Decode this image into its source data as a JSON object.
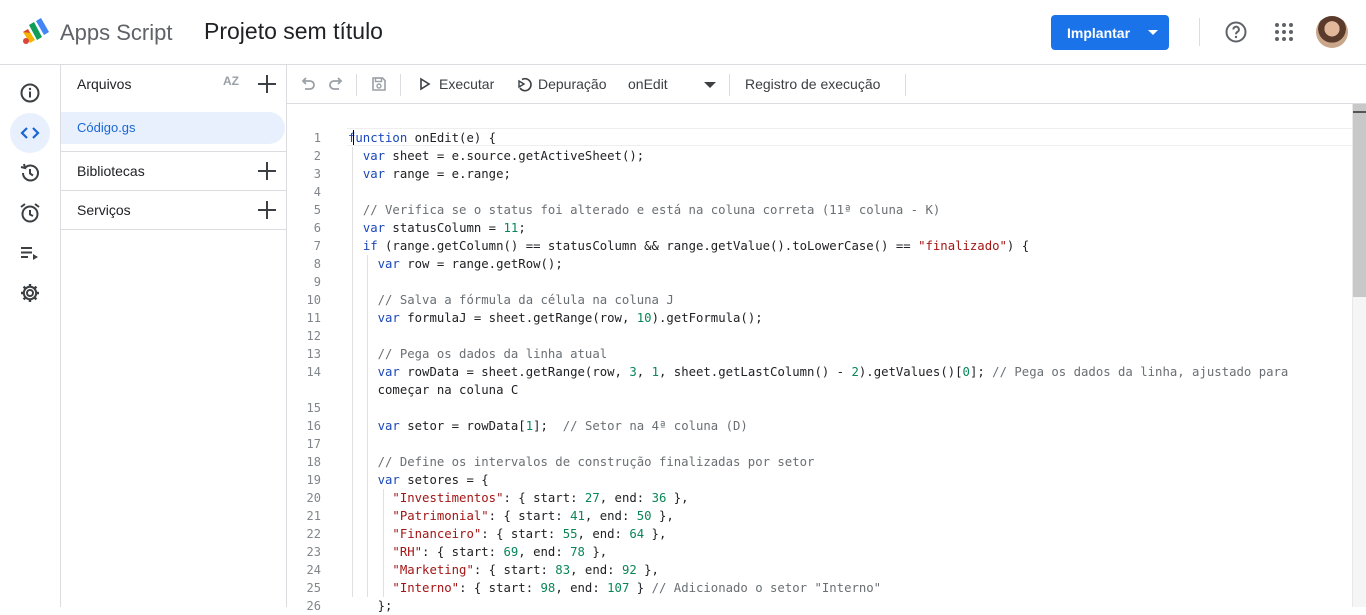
{
  "header": {
    "app_name": "Apps Script",
    "project_title": "Projeto sem título",
    "deploy_label": "Implantar"
  },
  "files_panel": {
    "title": "Arquivos",
    "sort_label": "AZ",
    "active_file": "Código.gs",
    "sections": [
      "Bibliotecas",
      "Serviços"
    ]
  },
  "toolbar": {
    "run_label": "Executar",
    "debug_label": "Depuração",
    "function_select": "onEdit",
    "exec_log_label": "Registro de execução"
  },
  "editor": {
    "line_numbers": [
      "1",
      "2",
      "3",
      "4",
      "5",
      "6",
      "7",
      "8",
      "9",
      "10",
      "11",
      "12",
      "13",
      "14",
      "",
      "15",
      "16",
      "17",
      "18",
      "19",
      "20",
      "21",
      "22",
      "23",
      "24",
      "25",
      "26"
    ],
    "lines": [
      "function onEdit(e) {",
      "  var sheet = e.source.getActiveSheet();",
      "  var range = e.range;",
      "",
      "  // Verifica se o status foi alterado e está na coluna correta (11ª coluna - K)",
      "  var statusColumn = 11;",
      "  if (range.getColumn() == statusColumn && range.getValue().toLowerCase() == \"finalizado\") {",
      "    var row = range.getRow();",
      "",
      "    // Salva a fórmula da célula na coluna J",
      "    var formulaJ = sheet.getRange(row, 10).getFormula();",
      "",
      "    // Pega os dados da linha atual",
      "    var rowData = sheet.getRange(row, 3, 1, sheet.getLastColumn() - 2).getValues()[0]; // Pega os dados da linha, ajustado para",
      "    começar na coluna C",
      "",
      "    var setor = rowData[1];  // Setor na 4ª coluna (D)",
      "",
      "    // Define os intervalos de construção finalizadas por setor",
      "    var setores = {",
      "      \"Investimentos\": { start: 27, end: 36 },",
      "      \"Patrimonial\": { start: 41, end: 50 },",
      "      \"Financeiro\": { start: 55, end: 64 },",
      "      \"RH\": { start: 69, end: 78 },",
      "      \"Marketing\": { start: 83, end: 92 },",
      "      \"Interno\": { start: 98, end: 107 } // Adicionado o setor \"Interno\"",
      "    };"
    ]
  },
  "colors": {
    "accent": "#1a73e8",
    "keyword": "#1a47b8",
    "string": "#a31515",
    "number": "#098658",
    "comment": "#6a6f73"
  }
}
